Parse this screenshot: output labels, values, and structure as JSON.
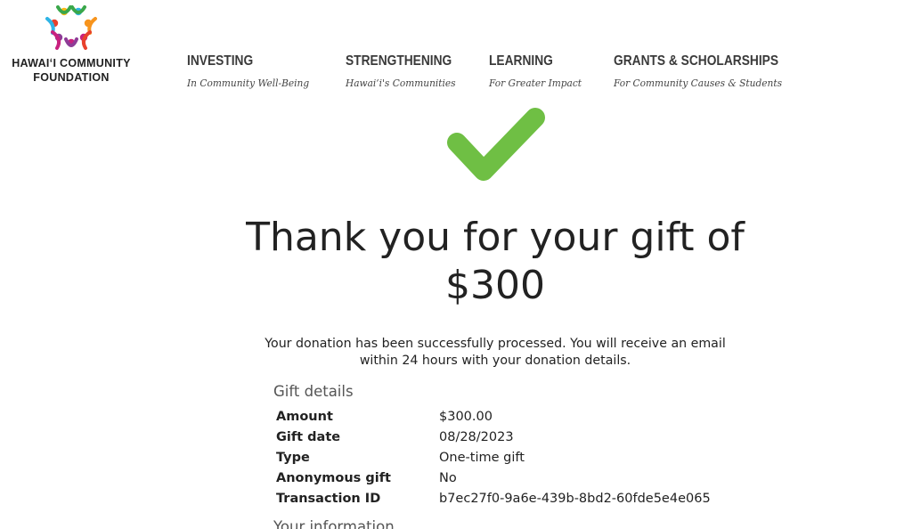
{
  "brand": {
    "name_line1": "HAWAIʻI COMMUNITY",
    "name_line2": "FOUNDATION",
    "logo_colors": [
      "#e8412c",
      "#f7941d",
      "#2eb4e6",
      "#3aa74a",
      "#8e3c97",
      "#c8217f",
      "#fdb913"
    ]
  },
  "nav": [
    {
      "title": "INVESTING",
      "subtitle": "In Community Well-Being"
    },
    {
      "title": "STRENGTHENING",
      "subtitle": "Hawaiʻi's Communities"
    },
    {
      "title": "LEARNING",
      "subtitle": "For Greater Impact"
    },
    {
      "title": "GRANTS & SCHOLARSHIPS",
      "subtitle": "For Community Causes & Students"
    }
  ],
  "confirmation": {
    "icon": "checkmark-icon",
    "icon_color": "#6fbf44",
    "headline_line1": "Thank you for your gift of",
    "headline_line2": "$300",
    "message_line1": "Your donation has been successfully processed. You will receive an email",
    "message_line2": "within 24 hours with your donation details."
  },
  "gift_details": {
    "title": "Gift details",
    "rows": [
      {
        "label": "Amount",
        "value": "$300.00"
      },
      {
        "label": "Gift date",
        "value": "08/28/2023"
      },
      {
        "label": "Type",
        "value": "One-time gift"
      },
      {
        "label": "Anonymous gift",
        "value": "No"
      },
      {
        "label": "Transaction ID",
        "value": "b7ec27f0-9a6e-439b-8bd2-60fde5e4e065"
      }
    ]
  },
  "your_information": {
    "title": "Your information"
  }
}
